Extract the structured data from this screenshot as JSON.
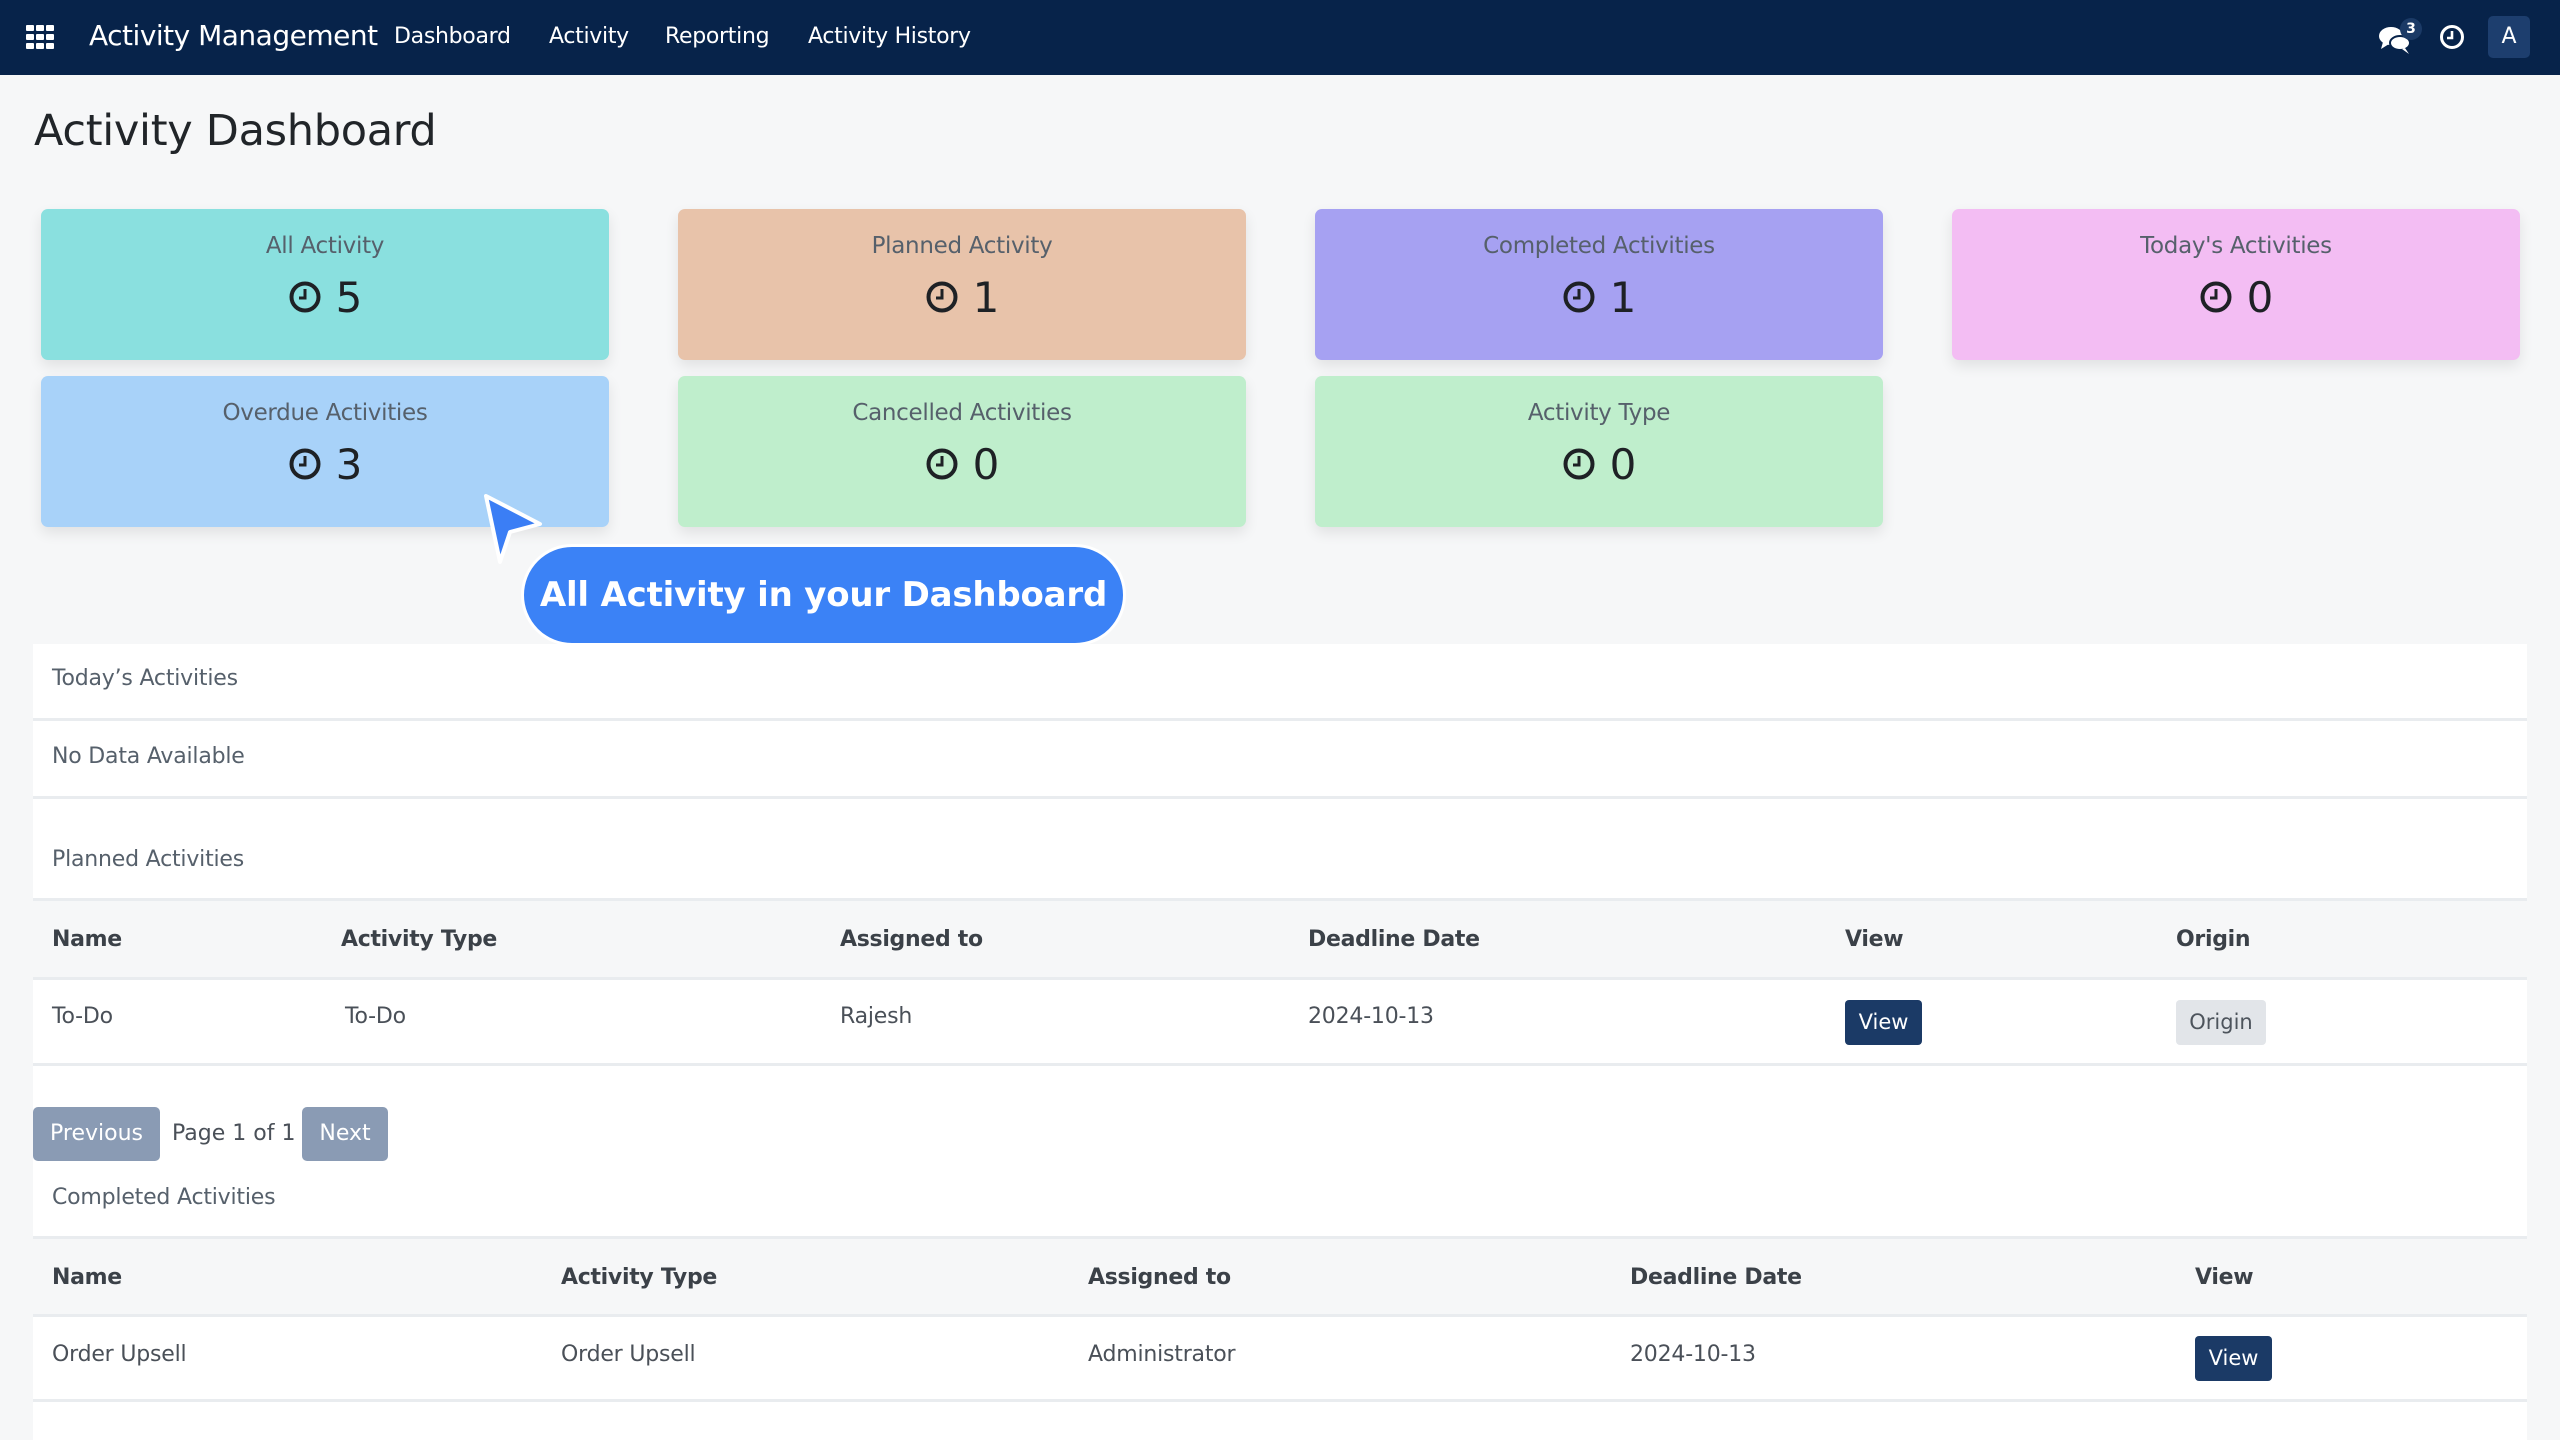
{
  "navbar": {
    "apps_icon": "grid-icon",
    "brand": "Activity Management",
    "links": [
      "Dashboard",
      "Activity",
      "Reporting",
      "Activity History"
    ],
    "chat_icon": "chat-bubbles-icon",
    "chat_badge": "3",
    "clock_icon": "clock-icon",
    "avatar_initial": "A"
  },
  "page": {
    "title": "Activity Dashboard"
  },
  "cards": [
    {
      "label": "All Activity",
      "value": "5",
      "color": "#8ae0df",
      "icon": "clock-icon"
    },
    {
      "label": "Planned Activity",
      "value": "1",
      "color": "#e8c3aa",
      "icon": "clock-icon"
    },
    {
      "label": "Completed Activities",
      "value": "1",
      "color": "#a6a1f2",
      "icon": "clock-icon"
    },
    {
      "label": "Today's Activities",
      "value": "0",
      "color": "#f3bdf3",
      "icon": "clock-icon"
    },
    {
      "label": "Overdue Activities",
      "value": "3",
      "color": "#a8d2f9",
      "icon": "clock-icon"
    },
    {
      "label": "Cancelled Activities",
      "value": "0",
      "color": "#bfeecc",
      "icon": "clock-icon"
    },
    {
      "label": "Activity Type",
      "value": "0",
      "color": "#bfeecc",
      "icon": "clock-icon"
    }
  ],
  "callout": {
    "text": "All Activity in your Dashboard",
    "color": "#3b82f6"
  },
  "todays": {
    "title": "Today’s Activities",
    "empty_text": "No Data Available"
  },
  "planned": {
    "title": "Planned Activities",
    "columns": [
      "Name",
      "Activity Type",
      "Assigned to",
      "Deadline Date",
      "View",
      "Origin"
    ],
    "rows": [
      {
        "name": "To-Do",
        "activity_type": "To-Do",
        "assigned_to": "Rajesh",
        "deadline": "2024-10-13",
        "view_label": "View",
        "origin_label": "Origin"
      }
    ],
    "pagination": {
      "previous": "Previous",
      "info": "Page 1 of 1",
      "next": "Next"
    }
  },
  "completed": {
    "title": "Completed Activities",
    "columns": [
      "Name",
      "Activity Type",
      "Assigned to",
      "Deadline Date",
      "View"
    ],
    "rows": [
      {
        "name": "Order Upsell",
        "activity_type": "Order Upsell",
        "assigned_to": "Administrator",
        "deadline": "2024-10-13",
        "view_label": "View"
      }
    ]
  }
}
